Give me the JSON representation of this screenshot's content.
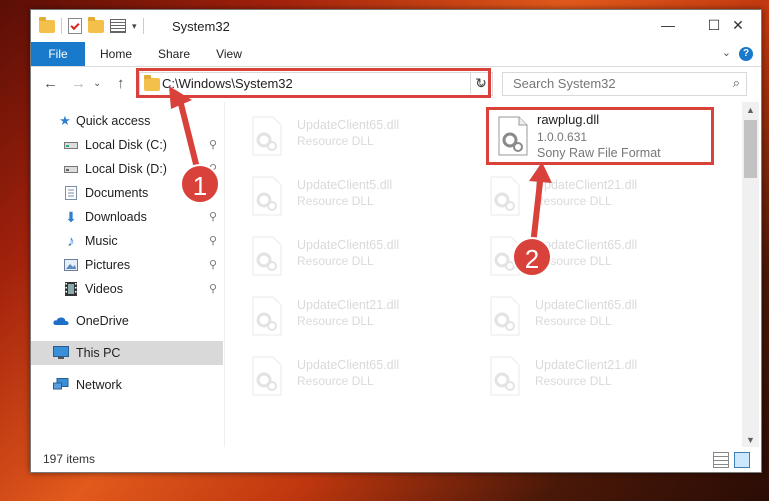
{
  "window": {
    "title": "System32",
    "controls": {
      "minimize": "—",
      "maximize": "☐",
      "close": "✕"
    }
  },
  "ribbon": {
    "tabs": [
      "File",
      "Home",
      "Share",
      "View"
    ],
    "help": "?"
  },
  "nav": {
    "back": "←",
    "forward": "→",
    "recent": "⌄",
    "up": "↑",
    "address": "C:\\Windows\\System32",
    "address_dropdown": "⌄",
    "refresh": "↻",
    "search_placeholder": "Search System32",
    "search_icon": "⌕"
  },
  "sidebar": {
    "items": [
      {
        "label": "Quick access",
        "icon": "star-icon",
        "pinned": false
      },
      {
        "label": "Local Disk (C:)",
        "icon": "drive-icon",
        "pinned": true
      },
      {
        "label": "Local Disk (D:)",
        "icon": "drive-icon",
        "pinned": true
      },
      {
        "label": "Documents",
        "icon": "documents-icon",
        "pinned": true
      },
      {
        "label": "Downloads",
        "icon": "downloads-icon",
        "pinned": true
      },
      {
        "label": "Music",
        "icon": "music-icon",
        "pinned": true
      },
      {
        "label": "Pictures",
        "icon": "pictures-icon",
        "pinned": true
      },
      {
        "label": "Videos",
        "icon": "videos-icon",
        "pinned": true
      },
      {
        "label": "OneDrive",
        "icon": "cloud-icon",
        "pinned": false
      },
      {
        "label": "This PC",
        "icon": "computer-icon",
        "pinned": false
      },
      {
        "label": "Network",
        "icon": "network-icon",
        "pinned": false
      }
    ],
    "pin_glyph": "📌"
  },
  "files": {
    "highlighted": {
      "name": "rawplug.dll",
      "version": "1.0.0.631",
      "description": "Sony Raw File Format"
    },
    "faded": [
      {
        "name": "UpdateClient65.dll",
        "description": "Resource DLL"
      },
      {
        "name": "UpdateClient5.dll",
        "description": "Resource DLL"
      },
      {
        "name": "UpdateClient21.dll",
        "description": "Resource DLL"
      },
      {
        "name": "UpdateClient65.dll",
        "description": "Resource DLL"
      },
      {
        "name": "UpdateClient65.dll",
        "description": "Resource DLL"
      },
      {
        "name": "UpdateClient21.dll",
        "description": "Resource DLL"
      },
      {
        "name": "UpdateClient65.dll",
        "description": "Resource DLL"
      },
      {
        "name": "UpdateClient65.dll",
        "description": "Resource DLL"
      },
      {
        "name": "UpdateClient21.dll",
        "description": "Resource DLL"
      }
    ]
  },
  "status": {
    "item_count": "197 items"
  },
  "callouts": {
    "step1": "1",
    "step2": "2",
    "color": "#d9423a"
  },
  "colors": {
    "accent": "#1979ca",
    "selection": "#cce8ff"
  }
}
